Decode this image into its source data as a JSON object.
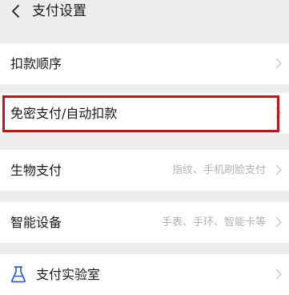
{
  "header": {
    "title": "支付设置"
  },
  "rows": [
    {
      "label": "扣款顺序",
      "value": ""
    },
    {
      "label": "免密支付/自动扣款",
      "value": ""
    },
    {
      "label": "生物支付",
      "value": "指纹、手机刷脸支付"
    },
    {
      "label": "智能设备",
      "value": "手表、手环、智能卡等"
    },
    {
      "label": "支付实验室",
      "value": ""
    }
  ],
  "colors": {
    "background": "#ededed",
    "row_bg": "#ffffff",
    "highlight": "#c0161a",
    "secondary_text": "#b2b2b2"
  }
}
